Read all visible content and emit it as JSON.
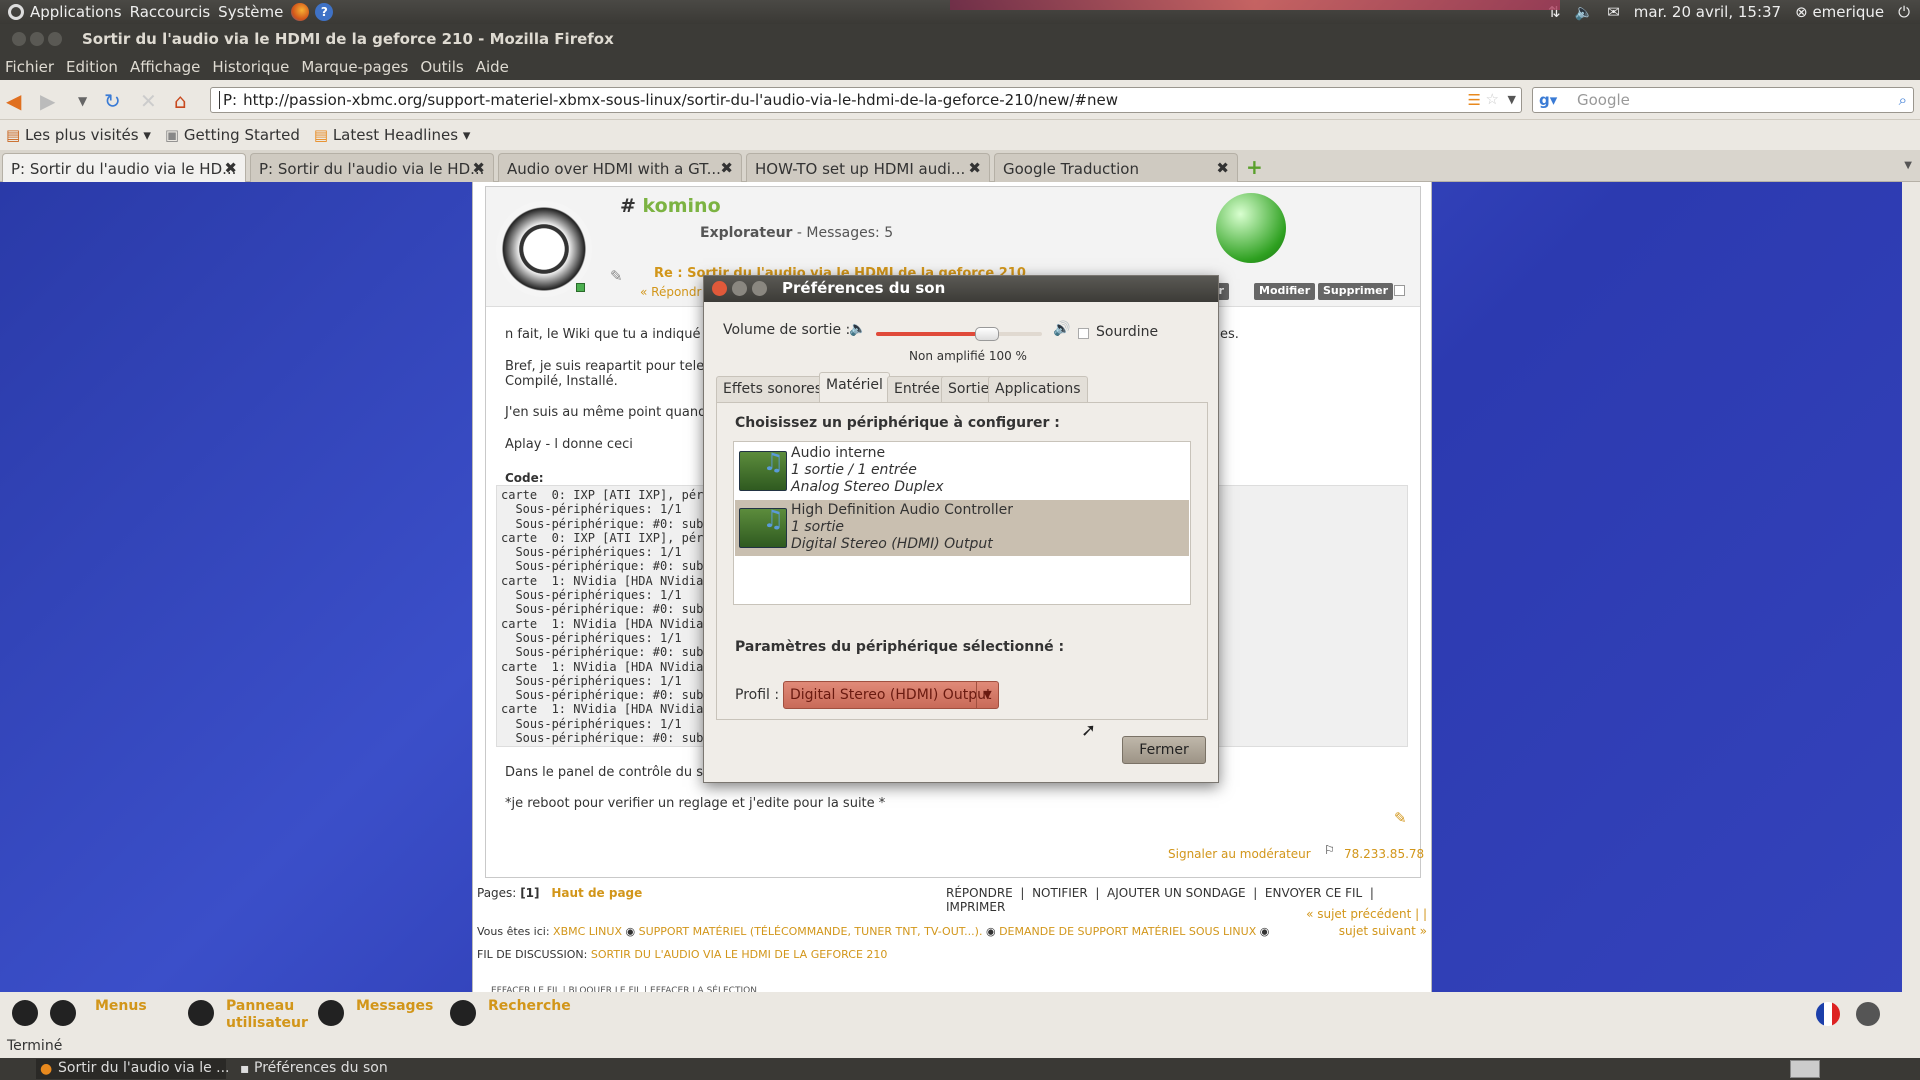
{
  "gnome_panel": {
    "menus": [
      "Applications",
      "Raccourcis",
      "Système"
    ],
    "clock": "mar. 20 avril, 15:37",
    "user": "emerique"
  },
  "window": {
    "title": "Sortir du l'audio via le HDMI de la geforce 210 - Mozilla Firefox"
  },
  "menubar": [
    "Fichier",
    "Edition",
    "Affichage",
    "Historique",
    "Marque-pages",
    "Outils",
    "Aide"
  ],
  "nav": {
    "url_prefix": "P:",
    "url": "http://passion-xbmc.org/support-materiel-xbmx-sous-linux/sortir-du-l'audio-via-le-hdmi-de-la-geforce-210/new/#new",
    "search_placeholder": "Google"
  },
  "bookmarks": [
    "Les plus visités ▾",
    "Getting Started",
    "Latest Headlines ▾"
  ],
  "tabs": [
    "P: Sortir du l'audio via le HD...",
    "P: Sortir du l'audio via le HD...",
    "Audio over HDMI with a GT...",
    "HOW-TO set up HDMI audi...",
    "Google Traduction"
  ],
  "post": {
    "hash": "#",
    "username": "komino",
    "rank": "Explorateur",
    "messages": "Messages: 5",
    "reply_title": "Re : Sortir du l'audio via le HDMI de la geforce 210",
    "reply_link": "« Répondr",
    "btn_cut": "er",
    "btn_modify": "Modifier",
    "btn_delete": "Supprimer",
    "lines": [
      "n fait, le Wiki que tu a indiqué repr",
      "Bref, je suis reapartit pour telechar",
      "Compilé, Installé.",
      "J'en suis au même point quand j'et",
      "Aplay - l  donne ceci"
    ],
    "line_right": "es.",
    "code_label": "Code:",
    "code": "carte  0: IXP [ATI IXP], péri\n  Sous-périphériques: 1/1\n  Sous-périphérique: #0: subd\ncarte  0: IXP [ATI IXP], péri\n  Sous-périphériques: 1/1\n  Sous-périphérique: #0: subd\ncarte  1: NVidia [HDA NVidia]\n  Sous-périphériques: 1/1\n  Sous-périphérique: #0: subd\ncarte  1: NVidia [HDA NVidia]\n  Sous-périphériques: 1/1\n  Sous-périphérique: #0: subd\ncarte  1: NVidia [HDA NVidia]\n  Sous-périphériques: 1/1\n  Sous-périphérique: #0: subd\ncarte  1: NVidia [HDA NVidia]\n  Sous-périphériques: 1/1\n  Sous-périphérique: #0: subd",
    "after_code": "Dans le panel de contrôle du son e",
    "reboot": "*je reboot pour verifier un reglage et j'edite pour la suite *",
    "report": "Signaler au modérateur",
    "ip": "78.233.85.78"
  },
  "page_footer": {
    "pages_label": "Pages:",
    "pages_value": "[1]",
    "top": "Haut de page",
    "actions": [
      "RÉPONDRE",
      "NOTIFIER",
      "AJOUTER UN SONDAGE",
      "ENVOYER CE FIL",
      "IMPRIMER"
    ],
    "breadcrumb_prefix": "Vous êtes ici:",
    "breadcrumb": [
      "XBMC LINUX",
      "SUPPORT MATÉRIEL (TÉLÉCOMMANDE, TUNER TNT, TV-OUT...).",
      "DEMANDE DE SUPPORT MATÉRIEL SOUS LINUX",
      "FIL DE DISCUSSION:",
      "SORTIR DU L'AUDIO VIA LE HDMI DE LA GEFORCE 210"
    ],
    "prev": "« sujet précédent | |",
    "next": "sujet suivant »",
    "cut_text": "EFFACER LE FIL   |   BLOQUER LE FIL   |   EFFACER LA SÉLECTION"
  },
  "site_bar": {
    "menus": "Menus",
    "panel1": "Panneau",
    "panel2": "utilisateur",
    "messages": "Messages",
    "search": "Recherche"
  },
  "dialog": {
    "title": "Préférences du son",
    "volume_label": "Volume de sortie :",
    "volume_level_pct": 100,
    "volume_caption": "Non amplifié 100 %",
    "mute_label": "Sourdine",
    "tabs": [
      "Effets sonores",
      "Matériel",
      "Entrée",
      "Sortie",
      "Applications"
    ],
    "choose_label": "Choisissez un périphérique à configurer :",
    "devices": [
      {
        "name": "Audio interne",
        "io": "1 sortie / 1 entrée",
        "profile": "Analog Stereo Duplex"
      },
      {
        "name": "High Definition Audio Controller",
        "io": "1 sortie",
        "profile": "Digital Stereo (HDMI) Output"
      }
    ],
    "params_label": "Paramètres du périphérique sélectionné :",
    "profile_label": "Profil :",
    "profile_value": "Digital Stereo (HDMI) Output",
    "close": "Fermer"
  },
  "status": "Terminé",
  "taskbar": [
    "Sortir du l'audio via le ...",
    "Préférences du son"
  ]
}
